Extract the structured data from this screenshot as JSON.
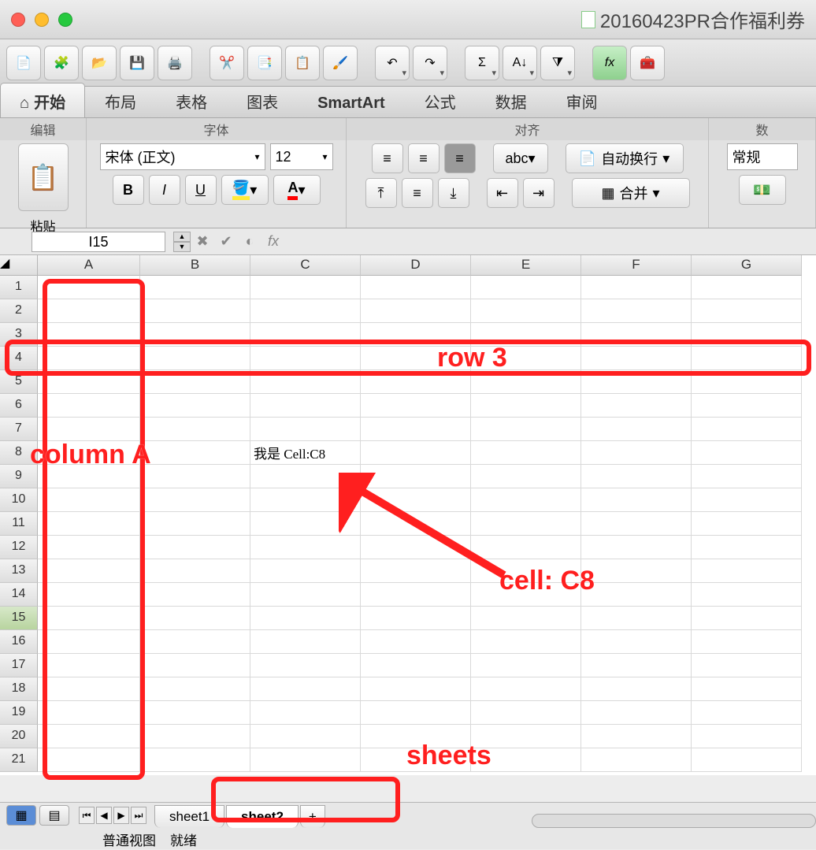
{
  "window": {
    "title": "20160423PR合作福利券"
  },
  "toolbar_icons": [
    "new-doc",
    "workbook",
    "open",
    "save",
    "print",
    "cut",
    "copy",
    "paste",
    "format-painter",
    "undo",
    "redo",
    "autosum",
    "sort",
    "filter",
    "fx",
    "toolbox"
  ],
  "ribbon_tabs": [
    "开始",
    "布局",
    "表格",
    "图表",
    "SmartArt",
    "公式",
    "数据",
    "审阅"
  ],
  "ribbon": {
    "edit_group": "编辑",
    "paste": "粘贴",
    "font_group": "字体",
    "font_name": "宋体 (正文)",
    "font_size": "12",
    "bold": "B",
    "italic": "I",
    "underline": "U",
    "align_group": "对齐",
    "abc": "abc",
    "wrap": "自动换行",
    "merge": "合并",
    "number_group": "数",
    "number_format": "常规"
  },
  "name_box": "I15",
  "fx_label": "fx",
  "grid": {
    "columns": [
      "A",
      "B",
      "C",
      "D",
      "E",
      "F",
      "G"
    ],
    "rows": [
      "1",
      "2",
      "3",
      "4",
      "5",
      "6",
      "7",
      "8",
      "9",
      "10",
      "11",
      "12",
      "13",
      "14",
      "15",
      "16",
      "17",
      "18",
      "19",
      "20",
      "21"
    ],
    "selected_row_header": "15",
    "cell_C8": "我是 Cell:C8"
  },
  "sheets": {
    "tab1": "sheet1",
    "tab2": "sheet2"
  },
  "status": {
    "view_label": "普通视图",
    "ready": "就绪"
  },
  "annotations": {
    "row3": "row 3",
    "colA": "column A",
    "cellC8": "cell: C8",
    "sheets": "sheets"
  },
  "chart_data": null
}
